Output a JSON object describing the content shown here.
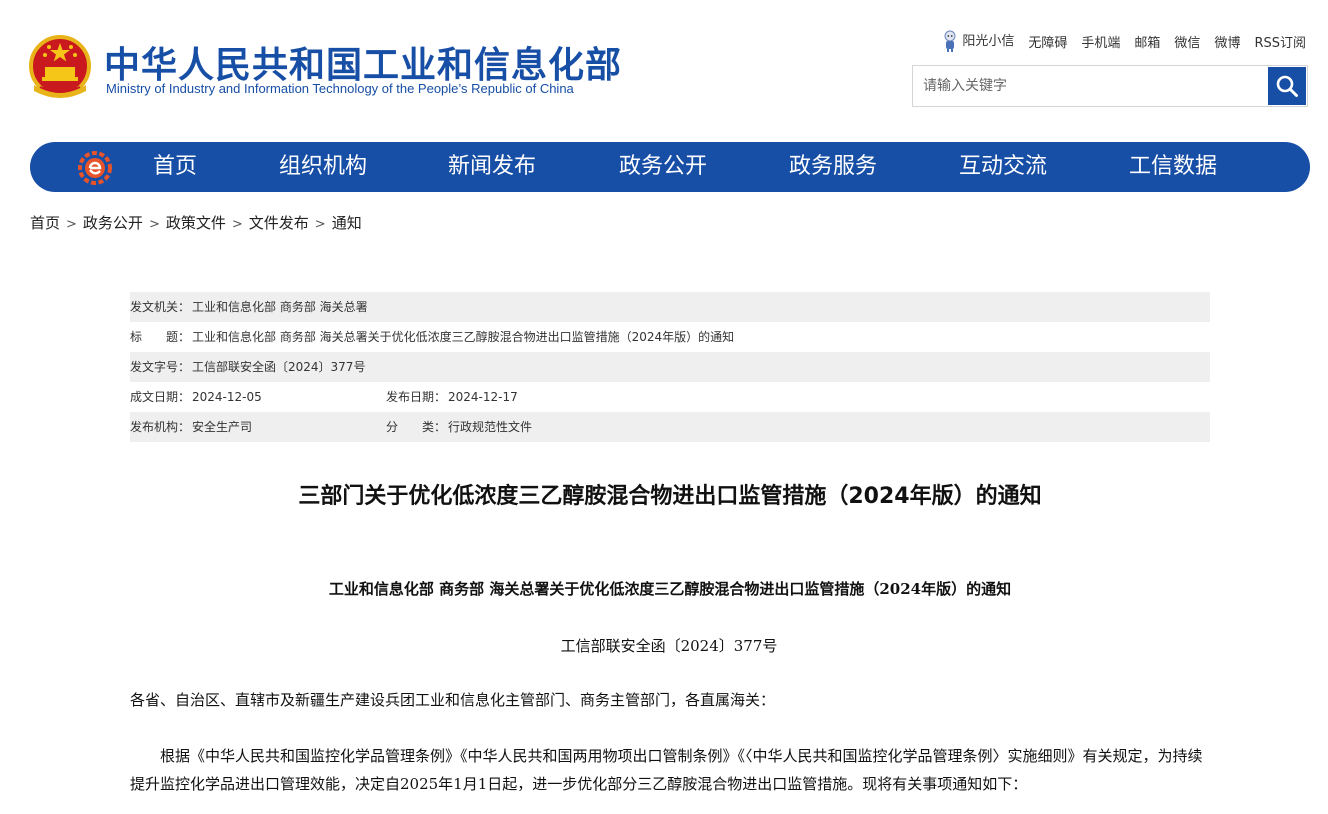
{
  "header": {
    "site_title": "中华人民共和国工业和信息化部",
    "site_subtitle": "Ministry of Industry and Information Technology of the People’s Republic of China",
    "top_links": [
      "阳光小信",
      "无障碍",
      "手机端",
      "邮箱",
      "微信",
      "微博",
      "RSS订阅"
    ],
    "search_placeholder": "请输入关键字"
  },
  "nav": {
    "items": [
      "首页",
      "组织机构",
      "新闻发布",
      "政务公开",
      "政务服务",
      "互动交流",
      "工信数据"
    ]
  },
  "breadcrumb": [
    "首页",
    "政务公开",
    "政策文件",
    "文件发布",
    "通知"
  ],
  "meta": {
    "issuer_label": "发文机关：",
    "issuer": "工业和信息化部 商务部 海关总署",
    "title_label": "标　　题：",
    "title": "工业和信息化部 商务部 海关总署关于优化低浓度三乙醇胺混合物进出口监管措施（2024年版）的通知",
    "docno_label": "发文字号：",
    "docno": "工信部联安全函〔2024〕377号",
    "date_label": "成文日期：",
    "date": "2024-12-05",
    "pubdate_label": "发布日期：",
    "pubdate": "2024-12-17",
    "org_label": "发布机构：",
    "org": "安全生产司",
    "category_label": "分　　类：",
    "category": "行政规范性文件"
  },
  "document": {
    "title": "三部门关于优化低浓度三乙醇胺混合物进出口监管措施（2024年版）的通知",
    "subtitle": "工业和信息化部  商务部  海关总署关于优化低浓度三乙醇胺混合物进出口监管措施（2024年版）的通知",
    "number": "工信部联安全函〔2024〕377号",
    "salutation": "各省、自治区、直辖市及新疆生产建设兵团工业和信息化主管部门、商务主管部门，各直属海关：",
    "paragraph1": "根据《中华人民共和国监控化学品管理条例》《中华人民共和国两用物项出口管制条例》《〈中华人民共和国监控化学品管理条例〉实施细则》有关规定，为持续提升监控化学品进出口管理效能，决定自2025年1月1日起，进一步优化部分三乙醇胺混合物进出口监管措施。现将有关事项通知如下："
  },
  "colors": {
    "brand_blue": "#174ea6",
    "meta_shade": "#efefef"
  }
}
